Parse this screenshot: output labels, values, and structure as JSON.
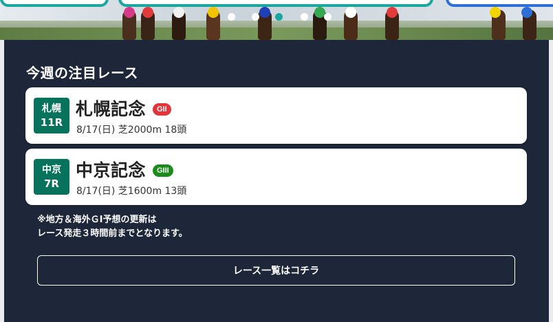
{
  "hero": {
    "slide_indicator": {
      "count": 5,
      "active_index": 2
    }
  },
  "section": {
    "title": "今週の注目レース"
  },
  "races": [
    {
      "venue": "札幌",
      "race_no": "11R",
      "name": "札幌記念",
      "grade": "GII",
      "grade_color": "#e0363b",
      "meta": "8/17(日) 芝2000m 18頭"
    },
    {
      "venue": "中京",
      "race_no": "7R",
      "name": "中京記念",
      "grade": "GIII",
      "grade_color": "#1b8c1b",
      "meta": "8/17(日) 芝1600m 13頭"
    }
  ],
  "notice": {
    "line1": "※地方＆海外ＧⅠ予想の更新は",
    "line2": "レース発走３時間前までとなります。"
  },
  "cta": {
    "label": "レース一覧はコチラ"
  },
  "colors": {
    "panel_bg": "#1d2739",
    "badge_bg": "#07735c",
    "accent_teal": "#1aa7a0"
  }
}
